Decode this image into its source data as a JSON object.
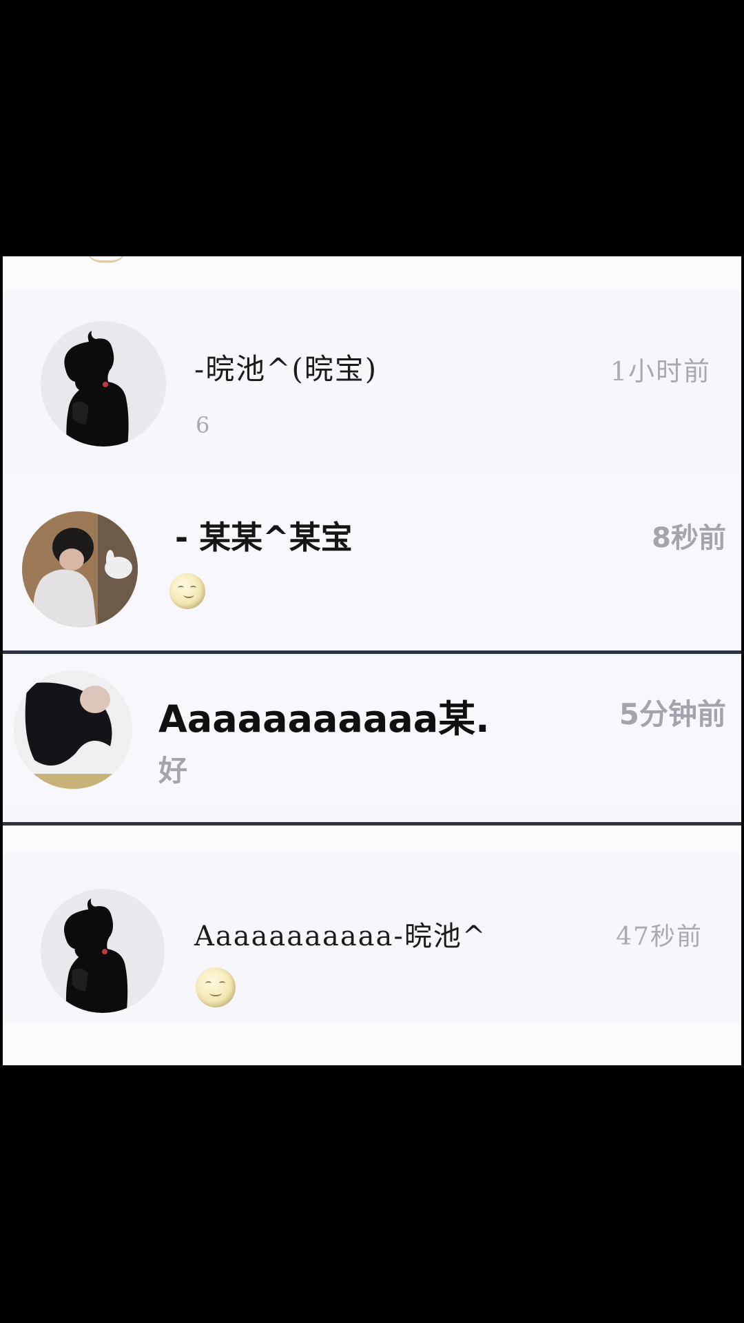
{
  "conversations": [
    {
      "name": "-晥池^(晥宝)",
      "time": "1小时前",
      "message": "6",
      "avatar_icon": "silhouette-avatar-icon"
    },
    {
      "name": "- 某某^某宝",
      "time": "8秒前",
      "message": "",
      "message_emoji": "smirk-moon-emoji-icon",
      "avatar_icon": "photo-avatar-icon"
    },
    {
      "name": "Aaaaaaaaaaa某.",
      "time": "5分钟前",
      "message": "好",
      "avatar_icon": "photo-avatar-icon"
    },
    {
      "name": "Aaaaaaaaaaa-晥池^",
      "time": "47秒前",
      "message": "",
      "message_emoji": "full-moon-face-emoji-icon",
      "avatar_icon": "silhouette-avatar-icon"
    }
  ],
  "colors": {
    "background": "#000000",
    "list_background": "#f7f6fa",
    "name_text": "#1b1b1b",
    "secondary_text": "#9c9ca6",
    "divider": "#2d3340"
  }
}
